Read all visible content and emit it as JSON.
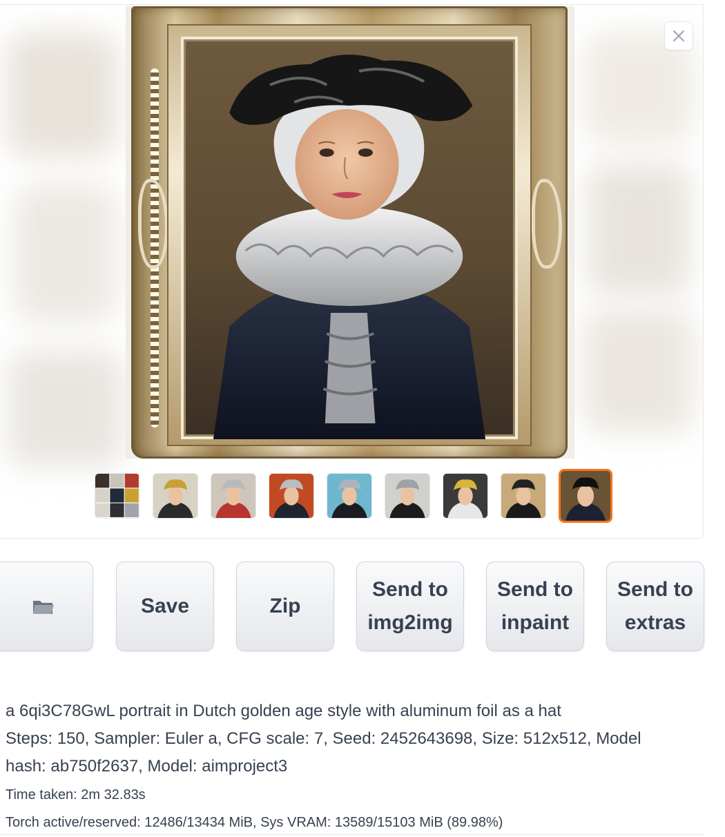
{
  "gallery": {
    "close_icon": "close-icon",
    "thumbnails": [
      {
        "name": "thumbnail-grid",
        "kind": "grid"
      },
      {
        "name": "thumbnail-gold-hat",
        "hat": "#c9a033",
        "bg": "#d8d2c4",
        "dress": "#2b2b2b"
      },
      {
        "name": "thumbnail-foil-hat-red",
        "hat": "#b7b9bd",
        "bg": "#cfc6bb",
        "dress": "#b8342e"
      },
      {
        "name": "thumbnail-foil-ruff",
        "hat": "#b9bcc2",
        "bg": "#c24a22",
        "dress": "#1e2430"
      },
      {
        "name": "thumbnail-blue-bg",
        "hat": "#aeb3bb",
        "bg": "#6fb7cf",
        "dress": "#1b1b22"
      },
      {
        "name": "thumbnail-tall-foil",
        "hat": "#9ea1a6",
        "bg": "#d2d0cc",
        "dress": "#1c1c20"
      },
      {
        "name": "thumbnail-gold-crown",
        "hat": "#d8b63a",
        "bg": "#3a3a3a",
        "dress": "#e7e7e7"
      },
      {
        "name": "thumbnail-framed-dark",
        "hat": "#222222",
        "bg": "#c7a97a",
        "dress": "#1a1a1a"
      },
      {
        "name": "thumbnail-selected-frame",
        "hat": "#111111",
        "bg": "#6a5234",
        "dress": "#1c2233"
      }
    ],
    "selected_index": 8,
    "accent": "#f97316"
  },
  "actions": {
    "folder_icon": "folder-icon",
    "save": "Save",
    "zip": "Zip",
    "send_img2img_1": "Send to",
    "send_img2img_2": "img2img",
    "send_inpaint_1": "Send to",
    "send_inpaint_2": "inpaint",
    "send_extras_1": "Send to",
    "send_extras_2": "extras"
  },
  "info": {
    "prompt": "a 6qi3C78GwL portrait in Dutch golden age style with aluminum foil as a hat",
    "params_line1": "Steps: 150, Sampler: Euler a, CFG scale: 7, Seed: 2452643698, Size: 512x512, Model",
    "params_line2": "hash: ab750f2637, Model: aimproject3",
    "time_taken": "Time taken: 2m 32.83s",
    "vram": "Torch active/reserved: 12486/13434 MiB, Sys VRAM: 13589/15103 MiB (89.98%)"
  }
}
